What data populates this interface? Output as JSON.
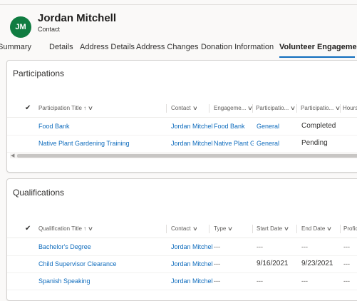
{
  "record": {
    "initials": "JM",
    "name": "Jordan Mitchell",
    "type": "Contact",
    "avatar_color": "#107c41"
  },
  "tabs": [
    {
      "label": "Summary"
    },
    {
      "label": "Details"
    },
    {
      "label": "Address Details"
    },
    {
      "label": "Address Changes"
    },
    {
      "label": "Donation Information"
    },
    {
      "label": "Volunteer Engagement",
      "active": true
    }
  ],
  "participations": {
    "title": "Participations",
    "columns": [
      "Participation Title ↑",
      "Contact",
      "Engageme...",
      "Participatio...",
      "Participatio...",
      "Hours"
    ],
    "rows": [
      {
        "title": "Food Bank",
        "contact": "Jordan Mitchell",
        "engagement": "Food Bank",
        "participation_type": "General",
        "status": "Completed"
      },
      {
        "title": "Native Plant Gardening Training",
        "contact": "Jordan Mitchell",
        "engagement": "Native Plant Gardening",
        "participation_type": "General",
        "status": "Pending"
      }
    ]
  },
  "qualifications": {
    "title": "Qualifications",
    "columns": [
      "Qualification Title ↑",
      "Contact",
      "Type",
      "Start Date",
      "End Date",
      "Proficiency"
    ],
    "rows": [
      {
        "title": "Bachelor's Degree",
        "contact": "Jordan Mitchell",
        "type": "---",
        "start": "---",
        "end": "---",
        "prof": "---"
      },
      {
        "title": "Child Supervisor Clearance",
        "contact": "Jordan Mitchell",
        "type": "---",
        "start": "9/16/2021",
        "end": "9/23/2021",
        "prof": "---"
      },
      {
        "title": "Spanish Speaking",
        "contact": "Jordan Mitchell",
        "type": "---",
        "start": "---",
        "end": "---",
        "prof": "---"
      }
    ]
  },
  "colors": {
    "accent": "#0f6cbd",
    "link": "#0f6cbd"
  }
}
